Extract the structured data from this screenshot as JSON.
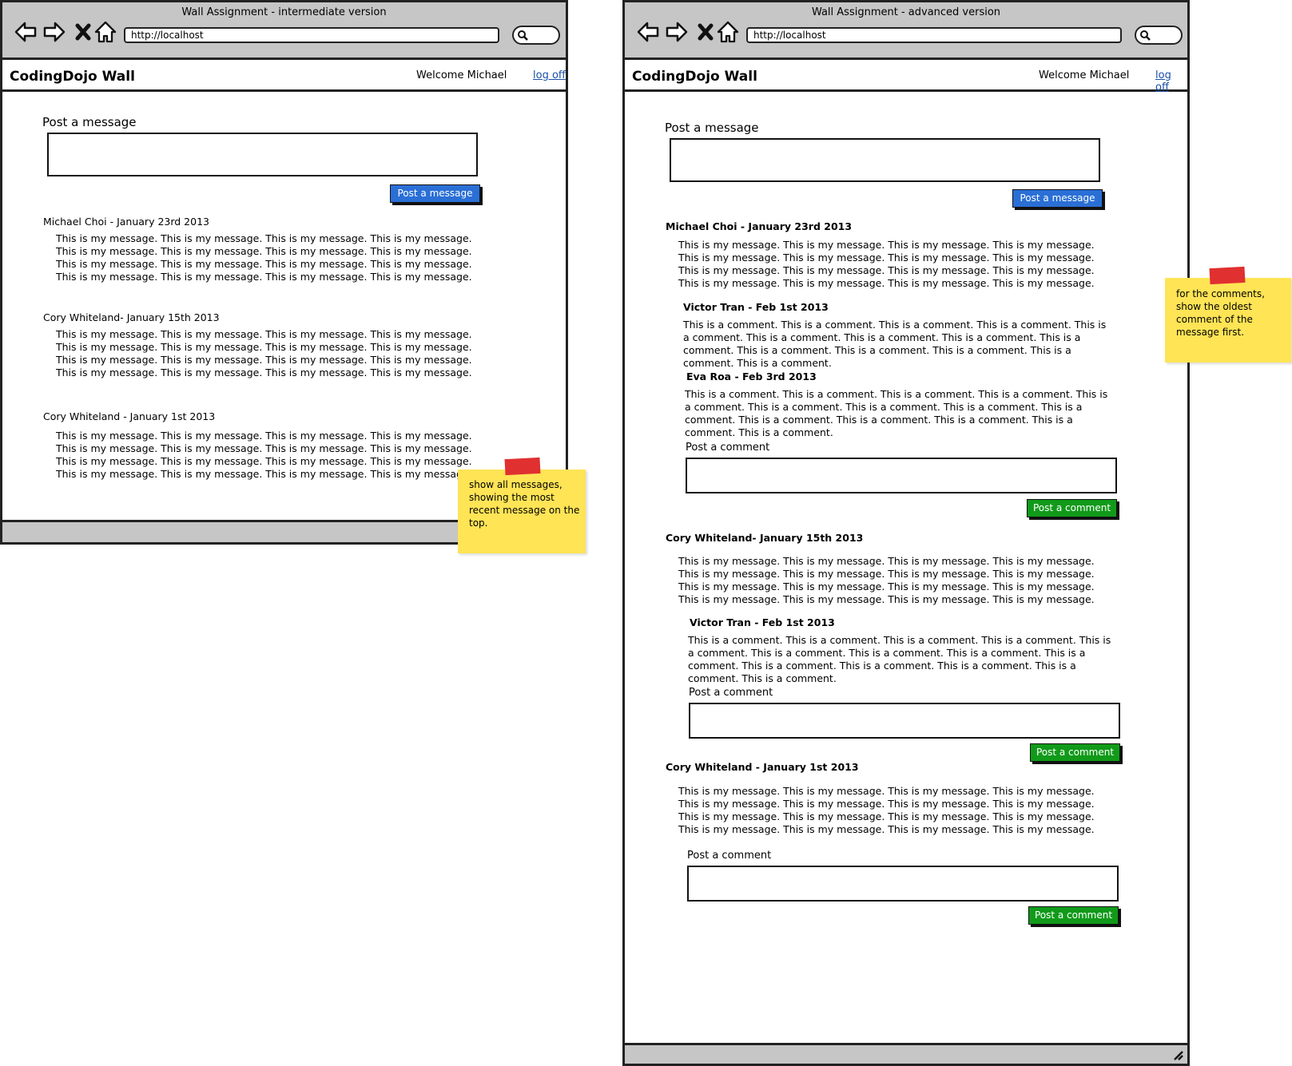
{
  "left_window": {
    "title": "Wall Assignment - intermediate version",
    "url": "http://localhost",
    "app_title": "CodingDojo Wall",
    "welcome": "Welcome Michael",
    "logoff": "log off",
    "post_label": "Post a message",
    "post_button": "Post a message",
    "messages": [
      {
        "header": "Michael Choi - January 23rd 2013",
        "body": "This is my message. This is my message. This is my message. This is my message. This is my message. This is my message. This is my message. This is my message. This is my message. This is my message. This is my message. This is my message. This is my message. This is my message. This is my message. This is my message."
      },
      {
        "header": "Cory Whiteland- January 15th 2013",
        "body": "This is my message. This is my message. This is my message. This is my message. This is my message. This is my message. This is my message. This is my message. This is my message. This is my message. This is my message. This is my message. This is my message. This is my message. This is my message. This is my message."
      },
      {
        "header": "Cory Whiteland - January 1st 2013",
        "body": "This is my message. This is my message. This is my message. This is my message. This is my message. This is my message. This is my message. This is my message. This is my message. This is my message. This is my message. This is my message. This is my message. This is my message. This is my message. This is my message."
      }
    ],
    "sticky_note": "show all messages, showing the most recent message on the top."
  },
  "right_window": {
    "title": "Wall Assignment - advanced version",
    "url": "http://localhost",
    "app_title": "CodingDojo Wall",
    "welcome": "Welcome Michael",
    "logoff": "log off",
    "post_label": "Post a message",
    "post_button": "Post a message",
    "comment_label": "Post a comment",
    "comment_button": "Post a comment",
    "messages": [
      {
        "header": "Michael Choi - January 23rd 2013",
        "body": "This is my message. This is my message. This is my message. This is my message. This is my message. This is my message. This is my message. This is my message. This is my message. This is my message. This is my message. This is my message. This is my message. This is my message. This is my message. This is my message.",
        "comments": [
          {
            "header": "Victor Tran - Feb 1st 2013",
            "body": "This is a comment. This is a comment. This is a comment. This is a comment. This is a comment. This is a comment. This is a comment. This is a comment. This is a comment. This is a comment. This is a comment. This is a comment. This is a comment. This is a comment."
          },
          {
            "header": "Eva Roa - Feb 3rd 2013",
            "body": "This is a comment. This is a comment. This is a comment. This is a comment. This is a comment. This is a comment. This is a comment. This is a comment. This is a comment. This is a comment. This is a comment. This is a comment. This is a comment. This is a comment."
          }
        ]
      },
      {
        "header": "Cory Whiteland- January 15th 2013",
        "body": "This is my message. This is my message. This is my message. This is my message. This is my message. This is my message. This is my message. This is my message. This is my message. This is my message. This is my message. This is my message. This is my message. This is my message. This is my message. This is my message.",
        "comments": [
          {
            "header": "Victor Tran - Feb 1st 2013",
            "body": "This is a comment. This is a comment. This is a comment. This is a comment. This is a comment. This is a comment. This is a comment. This is a comment. This is a comment. This is a comment. This is a comment. This is a comment. This is a comment. This is a comment."
          }
        ]
      },
      {
        "header": "Cory Whiteland - January 1st 2013",
        "body": "This is my message. This is my message. This is my message. This is my message. This is my message. This is my message. This is my message. This is my message. This is my message. This is my message. This is my message. This is my message. This is my message. This is my message. This is my message. This is my message.",
        "comments": []
      }
    ],
    "sticky_note": "for the comments, show the oldest comment of the message first."
  },
  "colors": {
    "post_button": "#2a6fd6",
    "comment_button": "#119a1a",
    "sticky": "#ffe455",
    "tape": "#e03030",
    "chrome": "#c6c6c6"
  }
}
